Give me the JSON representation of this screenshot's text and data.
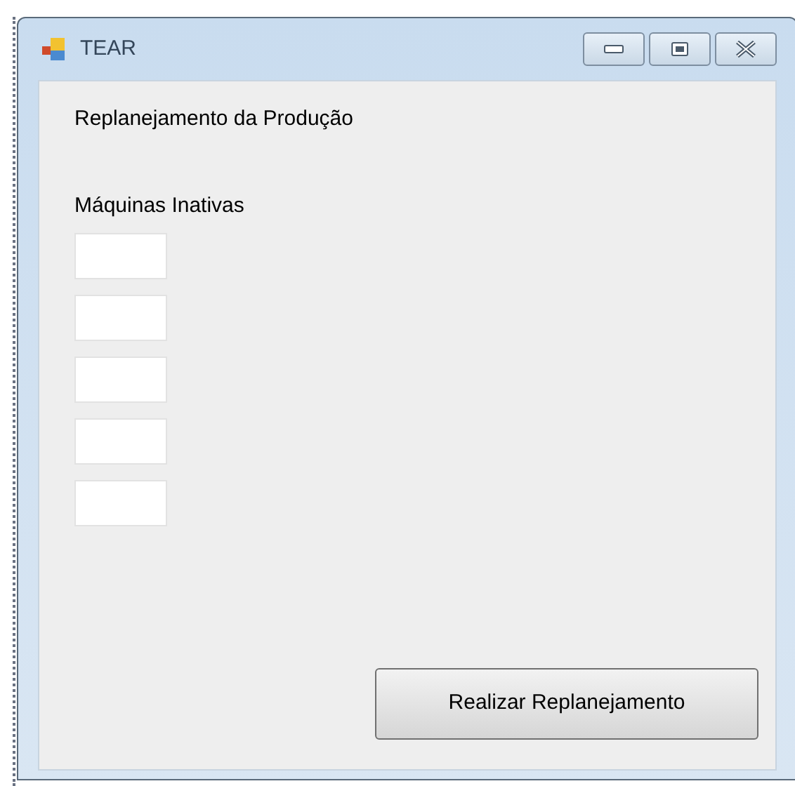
{
  "window": {
    "title": "TEAR"
  },
  "heading": "Replanejamento da Produção",
  "section_label": "Máquinas Inativas",
  "fields": [
    {
      "kind": "textbox"
    },
    {
      "kind": "textbox"
    },
    {
      "kind": "textbox"
    },
    {
      "kind": "textbox"
    },
    {
      "kind": "textbox"
    }
  ],
  "button": "Realizar Replanejamento"
}
